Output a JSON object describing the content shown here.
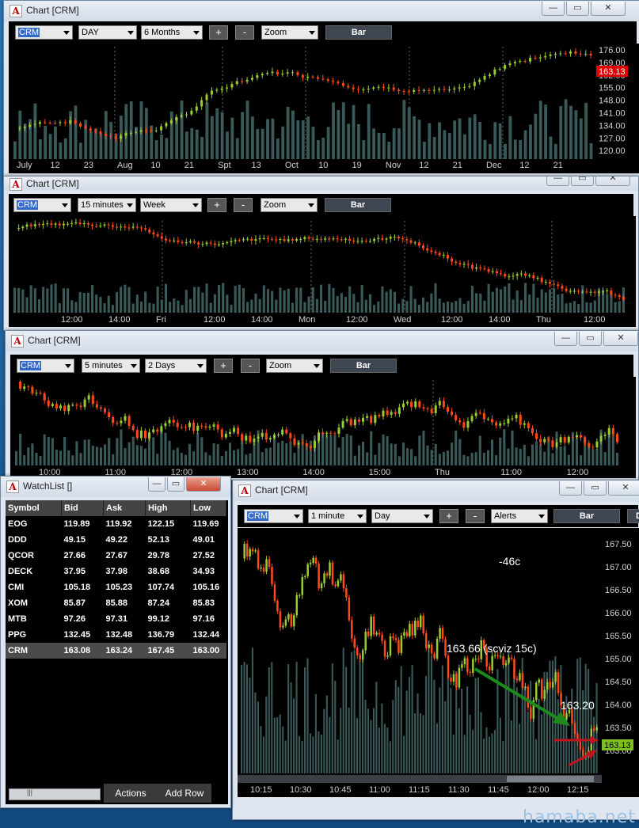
{
  "chart1": {
    "title": "Chart [CRM]",
    "symbol": "CRM",
    "interval": "DAY",
    "range": "6 Months",
    "plus": "+",
    "minus": "-",
    "zoom": "Zoom",
    "mode": "Bar",
    "xlabels": [
      "July",
      "12",
      "23",
      "Aug",
      "10",
      "21",
      "Spt",
      "13",
      "Oct",
      "10",
      "19",
      "Nov",
      "12",
      "21",
      "Dec",
      "12",
      "21"
    ],
    "ylabels": [
      "176.00",
      "169.00",
      "162.00",
      "155.00",
      "148.00",
      "141.00",
      "134.00",
      "127.00",
      "120.00"
    ],
    "last_price": "163.13"
  },
  "chart2": {
    "title": "Chart [CRM]",
    "symbol": "CRM",
    "interval": "15 minutes",
    "range": "Week",
    "plus": "+",
    "minus": "-",
    "zoom": "Zoom",
    "mode": "Bar",
    "xlabels": [
      "12:00",
      "14:00",
      "Fri",
      "12:00",
      "14:00",
      "Mon",
      "12:00",
      "Wed",
      "12:00",
      "14:00",
      "Thu",
      "12:00"
    ]
  },
  "chart3": {
    "title": "Chart [CRM]",
    "symbol": "CRM",
    "interval": "5 minutes",
    "range": "2 Days",
    "plus": "+",
    "minus": "-",
    "zoom": "Zoom",
    "mode": "Bar",
    "xlabels": [
      "10:00",
      "11:00",
      "12:00",
      "13:00",
      "14:00",
      "15:00",
      "Thu",
      "11:00",
      "12:00"
    ]
  },
  "chart4": {
    "title": "Chart [CRM]",
    "symbol": "CRM",
    "interval": "1 minute",
    "range": "Day",
    "plus": "+",
    "minus": "-",
    "alerts": "Alerts",
    "mode": "Bar",
    "extra": "D",
    "xlabels": [
      "10:15",
      "10:30",
      "10:45",
      "11:00",
      "11:15",
      "11:30",
      "11:45",
      "12:00",
      "12:15"
    ],
    "ylabels": [
      "167.50",
      "167.00",
      "166.50",
      "166.00",
      "165.50",
      "165.00",
      "164.50",
      "164.00",
      "163.50",
      "163.00"
    ],
    "last_price": "163.13",
    "note_top": "-46c",
    "note_mid": "163.66 (scviz 15c)",
    "note_right": "163.20"
  },
  "watchlist": {
    "title": "WatchList []",
    "headers": [
      "Symbol",
      "Bid",
      "Ask",
      "High",
      "Low"
    ],
    "rows": [
      {
        "sym": "EOG",
        "bid": "119.89",
        "ask": "119.92",
        "high": "122.15",
        "low": "119.69",
        "askdir": "up"
      },
      {
        "sym": "DDD",
        "bid": "49.15",
        "ask": "49.22",
        "high": "52.13",
        "low": "49.01",
        "askdir": "dn"
      },
      {
        "sym": "QCOR",
        "bid": "27.66",
        "ask": "27.67",
        "high": "29.78",
        "low": "27.52",
        "askdir": "dn"
      },
      {
        "sym": "DECK",
        "bid": "37.95",
        "ask": "37.98",
        "high": "38.68",
        "low": "34.93",
        "askdir": "dn"
      },
      {
        "sym": "CMI",
        "bid": "105.18",
        "ask": "105.23",
        "high": "107.74",
        "low": "105.16",
        "askdir": "up"
      },
      {
        "sym": "XOM",
        "bid": "85.87",
        "ask": "85.88",
        "high": "87.24",
        "low": "85.83",
        "askdir": "up"
      },
      {
        "sym": "MTB",
        "bid": "97.26",
        "ask": "97.31",
        "high": "99.12",
        "low": "97.16",
        "askdir": "dn"
      },
      {
        "sym": "PPG",
        "bid": "132.45",
        "ask": "132.48",
        "high": "136.79",
        "low": "132.44",
        "askdir": "up"
      },
      {
        "sym": "CRM",
        "bid": "163.08",
        "ask": "163.24",
        "high": "167.45",
        "low": "163.00",
        "askdir": "up"
      }
    ],
    "actions": "Actions",
    "add_row": "Add Row"
  },
  "watermark": "hamaba.net",
  "colors": {
    "up": "#9acd32",
    "down": "#ff4a1a",
    "volume": "#3a5a5a",
    "accent": "#3569c8",
    "green_arrow": "#1e8a1e",
    "red_arrow": "#c0141e"
  }
}
